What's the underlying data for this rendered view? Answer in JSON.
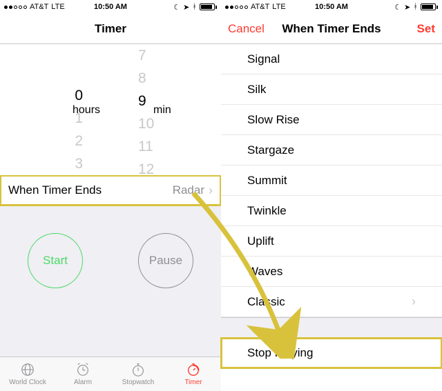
{
  "status": {
    "carrier": "AT&T",
    "network": "LTE",
    "time": "10:50 AM",
    "signal_dots_filled": 2,
    "signal_dots_total": 5
  },
  "left": {
    "title": "Timer",
    "picker": {
      "hours_above": [
        "",
        ""
      ],
      "hours_selected": "0",
      "hours_below": [
        "1",
        "2",
        "3"
      ],
      "hours_unit": "hours",
      "min_above": [
        "7",
        "8"
      ],
      "min_selected": "9",
      "min_below": [
        "10",
        "11",
        "12"
      ],
      "min_unit": "min"
    },
    "when_ends_label": "When Timer Ends",
    "when_ends_value": "Radar",
    "start_label": "Start",
    "pause_label": "Pause",
    "tabs": {
      "world_clock": "World Clock",
      "alarm": "Alarm",
      "stopwatch": "Stopwatch",
      "timer": "Timer"
    }
  },
  "right": {
    "cancel": "Cancel",
    "title": "When Timer Ends",
    "set": "Set",
    "sounds": [
      "Signal",
      "Silk",
      "Slow Rise",
      "Stargaze",
      "Summit",
      "Twinkle",
      "Uplift",
      "Waves",
      "Classic"
    ],
    "stop_playing": "Stop Playing"
  },
  "annotation": {
    "highlight_color": "#d8c23c"
  }
}
